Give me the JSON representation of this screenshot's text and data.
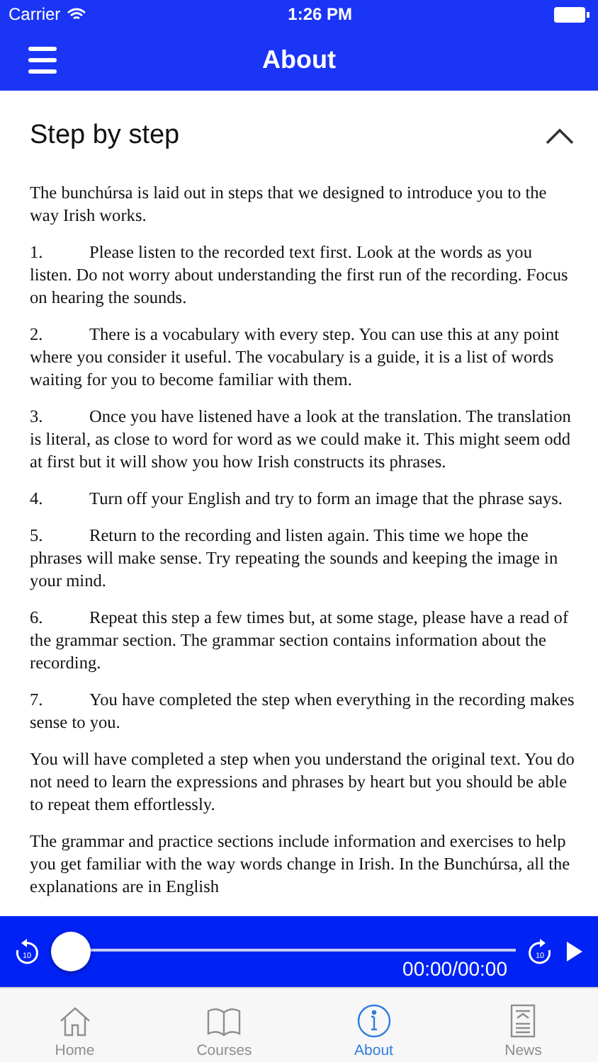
{
  "status_bar": {
    "carrier": "Carrier",
    "time": "1:26 PM"
  },
  "header": {
    "title": "About"
  },
  "section": {
    "title": "Step by step",
    "expanded": true,
    "paragraphs": [
      {
        "kind": "plain",
        "text": "The bunchúrsa is laid out in steps that we designed to introduce you to the way Irish works."
      },
      {
        "kind": "numbered",
        "number": "1.",
        "text": "Please listen to the recorded text first. Look at the words as you listen. Do not worry about understanding the first run of the recording. Focus on hearing the sounds."
      },
      {
        "kind": "numbered",
        "number": "2.",
        "text": "There is a vocabulary with every step. You can use this at any point where you consider it useful. The vocabulary is a guide, it is a list of words waiting for you to become familiar with them."
      },
      {
        "kind": "numbered",
        "number": "3.",
        "text": "Once you have listened have a look at the translation. The translation is literal, as close to word for word as we could make it. This might seem odd at first but it will show you how Irish constructs its phrases."
      },
      {
        "kind": "numbered",
        "number": "4.",
        "text": "Turn off your English and try to form an image that the phrase says."
      },
      {
        "kind": "numbered",
        "number": "5.",
        "text": "Return to the recording and listen again. This time we hope the phrases will make sense. Try repeating the sounds and keeping the image in your mind."
      },
      {
        "kind": "numbered",
        "number": "6.",
        "text": "Repeat this step a few times but, at some stage, please have a read of the grammar section. The grammar section contains information about the recording."
      },
      {
        "kind": "numbered",
        "number": "7.",
        "text": "You have completed the step when everything in the recording makes sense to you."
      },
      {
        "kind": "plain",
        "text": "You will have completed a step when you understand the original text. You do not need to learn the expressions and phrases by heart but you should be able to repeat them effortlessly."
      },
      {
        "kind": "plain",
        "text": "The grammar and practice sections include information and exercises to help you get familiar with the way words change in Irish. In the Bunchúrsa, all the explanations are in English"
      }
    ]
  },
  "player": {
    "level": 0,
    "time": "00:00/00:00",
    "rewind_label": "10",
    "forward_label": "10"
  },
  "tabs": [
    {
      "label": "Home",
      "kind": "home",
      "selected": false
    },
    {
      "label": "Courses",
      "kind": "book",
      "selected": false
    },
    {
      "label": "About",
      "kind": "info",
      "selected": true
    },
    {
      "label": "News",
      "kind": "news",
      "selected": false
    }
  ]
}
